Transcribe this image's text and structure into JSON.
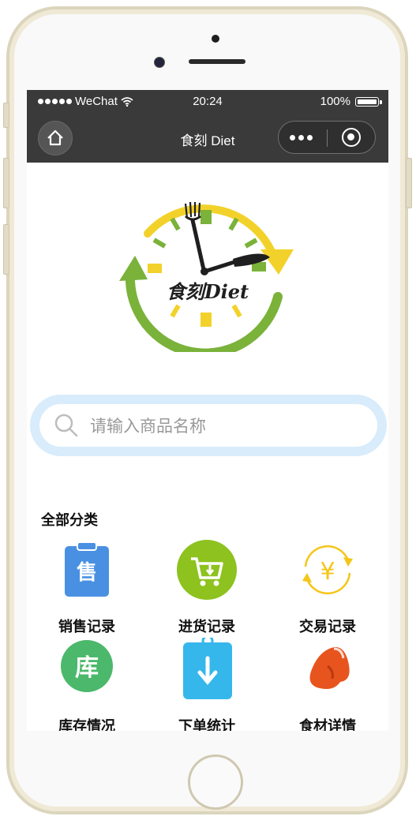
{
  "statusbar": {
    "carrier": "WeChat",
    "time": "20:24",
    "battery": "100%"
  },
  "navbar": {
    "title": "食刻 Diet"
  },
  "logo": {
    "brand_text": "食刻Diet",
    "colors": {
      "yellow": "#f2d22a",
      "green": "#7ab23a",
      "dark": "#1f1f1f"
    }
  },
  "search": {
    "placeholder": "请输入商品名称"
  },
  "categories": {
    "title": "全部分类",
    "items": [
      {
        "label": "销售记录",
        "icon": "sales-clipboard-icon",
        "glyph": "售",
        "color": "#4a90e2"
      },
      {
        "label": "进货记录",
        "icon": "purchase-cart-icon",
        "color": "#8dc21f"
      },
      {
        "label": "交易记录",
        "icon": "yuan-exchange-icon",
        "glyph": "¥",
        "color": "#f5c518"
      },
      {
        "label": "库存情况",
        "icon": "inventory-icon",
        "glyph": "库",
        "color": "#4cb86b"
      },
      {
        "label": "下单统计",
        "icon": "order-download-icon",
        "color": "#35b7ec"
      },
      {
        "label": "食材详情",
        "icon": "ingredient-bean-icon",
        "color": "#e8541e"
      }
    ]
  }
}
